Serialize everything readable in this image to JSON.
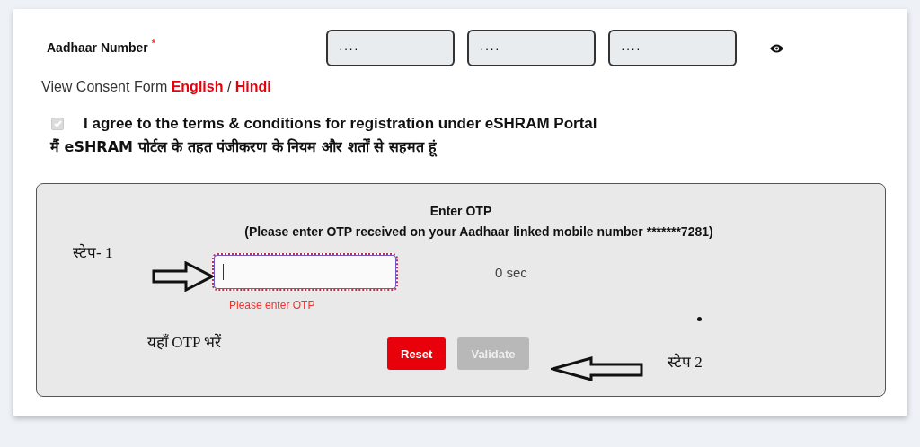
{
  "aadhaar": {
    "label": "Aadhaar Number",
    "required_mark": "*",
    "fields": [
      {
        "value": "····"
      },
      {
        "value": "····"
      },
      {
        "value": "····"
      }
    ]
  },
  "consent": {
    "prefix": "View Consent Form",
    "links": [
      {
        "label": "English"
      },
      {
        "label": "Hindi"
      }
    ],
    "separator": "/"
  },
  "agreement": {
    "checked": true,
    "disabled": true,
    "text_en": "I agree to the terms & conditions for registration under eSHRAM Portal",
    "text_hi": "मैं eSHRAM पोर्टल के तहत पंजीकरण के नियम और शर्तों से सहमत हूं"
  },
  "otp": {
    "title": "Enter OTP",
    "subtitle": "(Please enter OTP received on your Aadhaar linked mobile number *******7281)",
    "focused": true,
    "timer": "0 sec",
    "error": "Please enter OTP",
    "buttons": [
      {
        "label": "Reset",
        "disabled": false
      },
      {
        "label": "Validate",
        "disabled": true
      }
    ]
  },
  "annotations": [
    {
      "kind": "label",
      "text": "स्टेप- 1"
    },
    {
      "kind": "arrow-right"
    },
    {
      "kind": "label",
      "text": "यहाँ OTP भरें"
    },
    {
      "kind": "dot"
    },
    {
      "kind": "arrow-left"
    },
    {
      "kind": "label",
      "text": "स्टेप 2"
    }
  ]
}
